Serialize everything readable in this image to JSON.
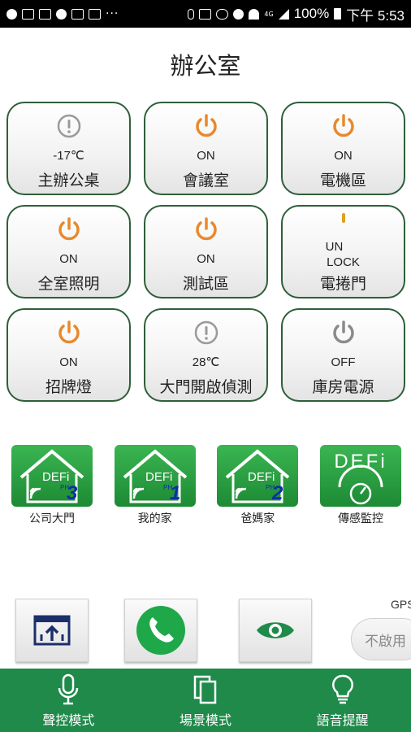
{
  "statusbar": {
    "more": "···",
    "battery": "100%",
    "time": "下午 5:53",
    "network": "4G"
  },
  "page": {
    "title": "辦公室"
  },
  "tiles": [
    {
      "name": "主辦公桌",
      "status": "-17℃",
      "icon": "alert-icon",
      "color": "#9a9a9a"
    },
    {
      "name": "會議室",
      "status": "ON",
      "icon": "power-icon",
      "color": "#e8892d"
    },
    {
      "name": "電機區",
      "status": "ON",
      "icon": "power-icon",
      "color": "#e8892d"
    },
    {
      "name": "全室照明",
      "status": "ON",
      "icon": "power-icon",
      "color": "#e8892d"
    },
    {
      "name": "測試區",
      "status": "ON",
      "icon": "power-icon",
      "color": "#e8892d"
    },
    {
      "name": "電捲門",
      "status_line1": "UN",
      "status_line2": "LOCK",
      "icon": "lock-icon",
      "color": "#e0a020"
    },
    {
      "name": "招牌燈",
      "status": "ON",
      "icon": "power-icon",
      "color": "#e8892d"
    },
    {
      "name": "大門開啟偵測",
      "status": "28℃",
      "icon": "alert-icon",
      "color": "#9a9a9a"
    },
    {
      "name": "庫房電源",
      "status": "OFF",
      "icon": "power-icon",
      "color": "#8a8a8a"
    }
  ],
  "homes": [
    {
      "label": "公司大門",
      "badge": "DEFi",
      "sub": "PH",
      "num": "3"
    },
    {
      "label": "我的家",
      "badge": "DEFi",
      "sub": "PH",
      "num": "1"
    },
    {
      "label": "爸媽家",
      "badge": "DEFi",
      "sub": "PH",
      "num": "2"
    },
    {
      "label": "傳感監控",
      "badge": "DEFi"
    }
  ],
  "actions": {
    "gps_label": "GPS",
    "gps_toggle": "不啟用"
  },
  "bottombar": [
    {
      "label": "聲控模式",
      "icon": "microphone-icon"
    },
    {
      "label": "場景模式",
      "icon": "copy-icon"
    },
    {
      "label": "語音提醒",
      "icon": "lightbulb-icon"
    }
  ],
  "colors": {
    "accent_green": "#1f8a4a",
    "tile_border": "#2e5f3a",
    "power_on": "#e8892d"
  }
}
